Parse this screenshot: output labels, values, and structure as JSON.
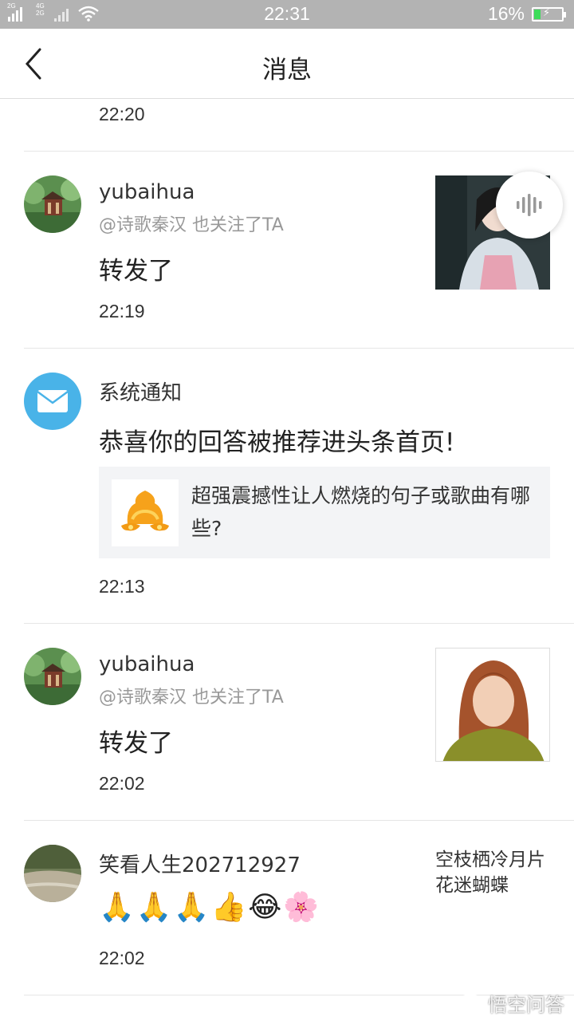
{
  "status_bar": {
    "sim1": "2G",
    "sim2_top": "4G",
    "sim2_bottom": "2G",
    "time": "22:31",
    "battery": "16%",
    "icons": [
      "signal-icon",
      "signal-icon",
      "wifi-icon",
      "battery-charging-icon"
    ]
  },
  "header": {
    "title": "消息",
    "back_icon": "chevron-left-icon"
  },
  "messages": [
    {
      "time": "22:20"
    },
    {
      "name": "yubaihua",
      "mention": "@诗歌秦汉 也关注了TA",
      "content": "转发了",
      "time": "22:19"
    },
    {
      "name": "系统通知",
      "content": "恭喜你的回答被推荐进头条首页!",
      "card_text": "超强震撼性让人燃烧的句子或歌曲有哪些?",
      "time": "22:13",
      "icon": "mail-icon"
    },
    {
      "name": "yubaihua",
      "mention": "@诗歌秦汉 也关注了TA",
      "content": "转发了",
      "time": "22:02"
    },
    {
      "name": "笑看人生202712927",
      "emojis": "🙏🙏🙏👍😂🌸",
      "side_text": "空枝栖冷月片花迷蝴蝶",
      "time": "22:02"
    }
  ],
  "voice_button": {
    "icon": "voice-wave-icon"
  },
  "watermark": "悟空问答",
  "colors": {
    "status_bar": "#b3b3b3",
    "mail_icon_bg": "#49b3e8",
    "card_bg": "#f3f4f6"
  }
}
